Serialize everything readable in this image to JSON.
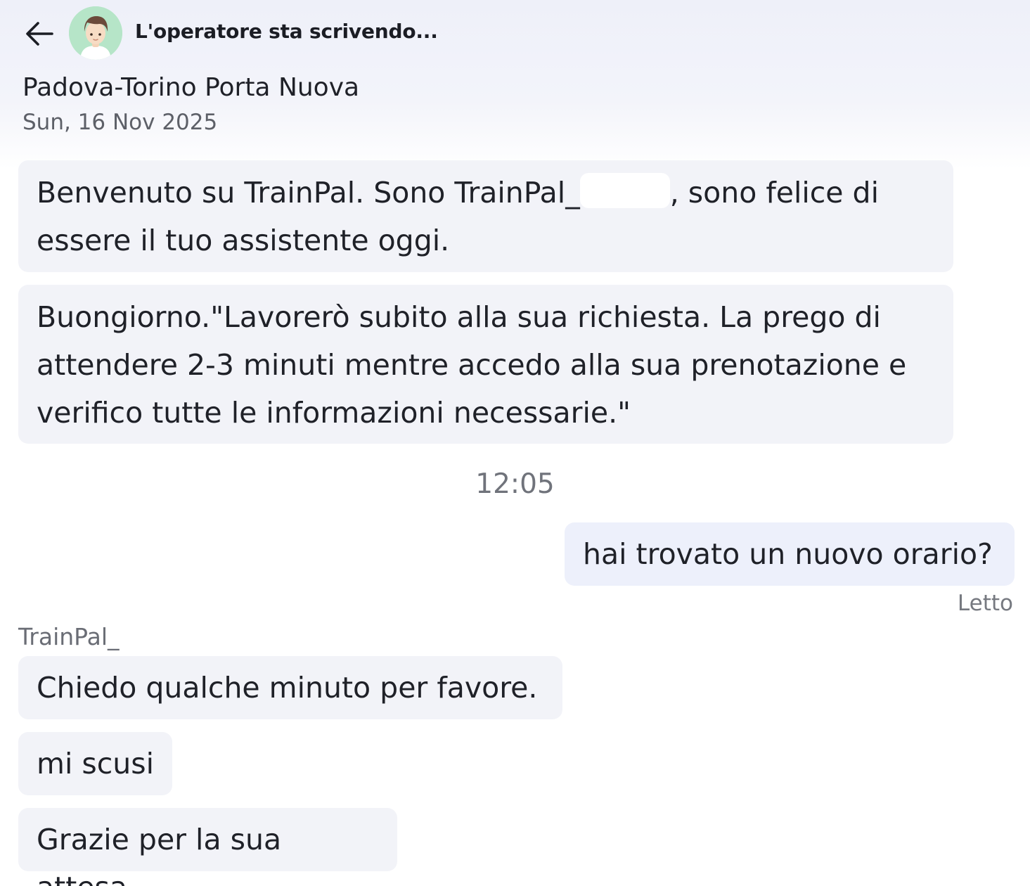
{
  "header": {
    "status": "L'operatore sta scrivendo...",
    "route": "Padova-Torino Porta Nuova",
    "date": "Sun, 16 Nov 2025"
  },
  "messages": [
    {
      "direction": "incoming",
      "line1_prefix": "Benvenuto su TrainPal. Sono TrainPal_",
      "line1_suffix": ", sono felice di",
      "line2": "essere il tuo assistente oggi."
    },
    {
      "direction": "incoming",
      "lines": [
        "Buongiorno.\"Lavorerò subito alla sua richiesta. La prego di",
        "attendere 2-3 minuti mentre accedo alla sua prenotazione e",
        "verifico tutte le informazioni necessarie.\""
      ]
    },
    {
      "direction": "outgoing",
      "text": "hai trovato un nuovo orario?"
    },
    {
      "direction": "incoming",
      "text": "Chiedo qualche minuto per favore."
    },
    {
      "direction": "incoming",
      "text": "mi scusi"
    },
    {
      "direction": "incoming",
      "text": "Grazie per la sua attesa"
    }
  ],
  "timestamp": "12:05",
  "read_receipt": "Letto",
  "sender_name": "TrainPal_",
  "icons": {
    "back": "arrow-left-icon",
    "avatar": "operator-avatar"
  },
  "colors": {
    "incoming_bubble": "#f2f3f8",
    "outgoing_bubble": "#edf0fb",
    "text": "#1f2128",
    "meta_text": "#70737b"
  }
}
